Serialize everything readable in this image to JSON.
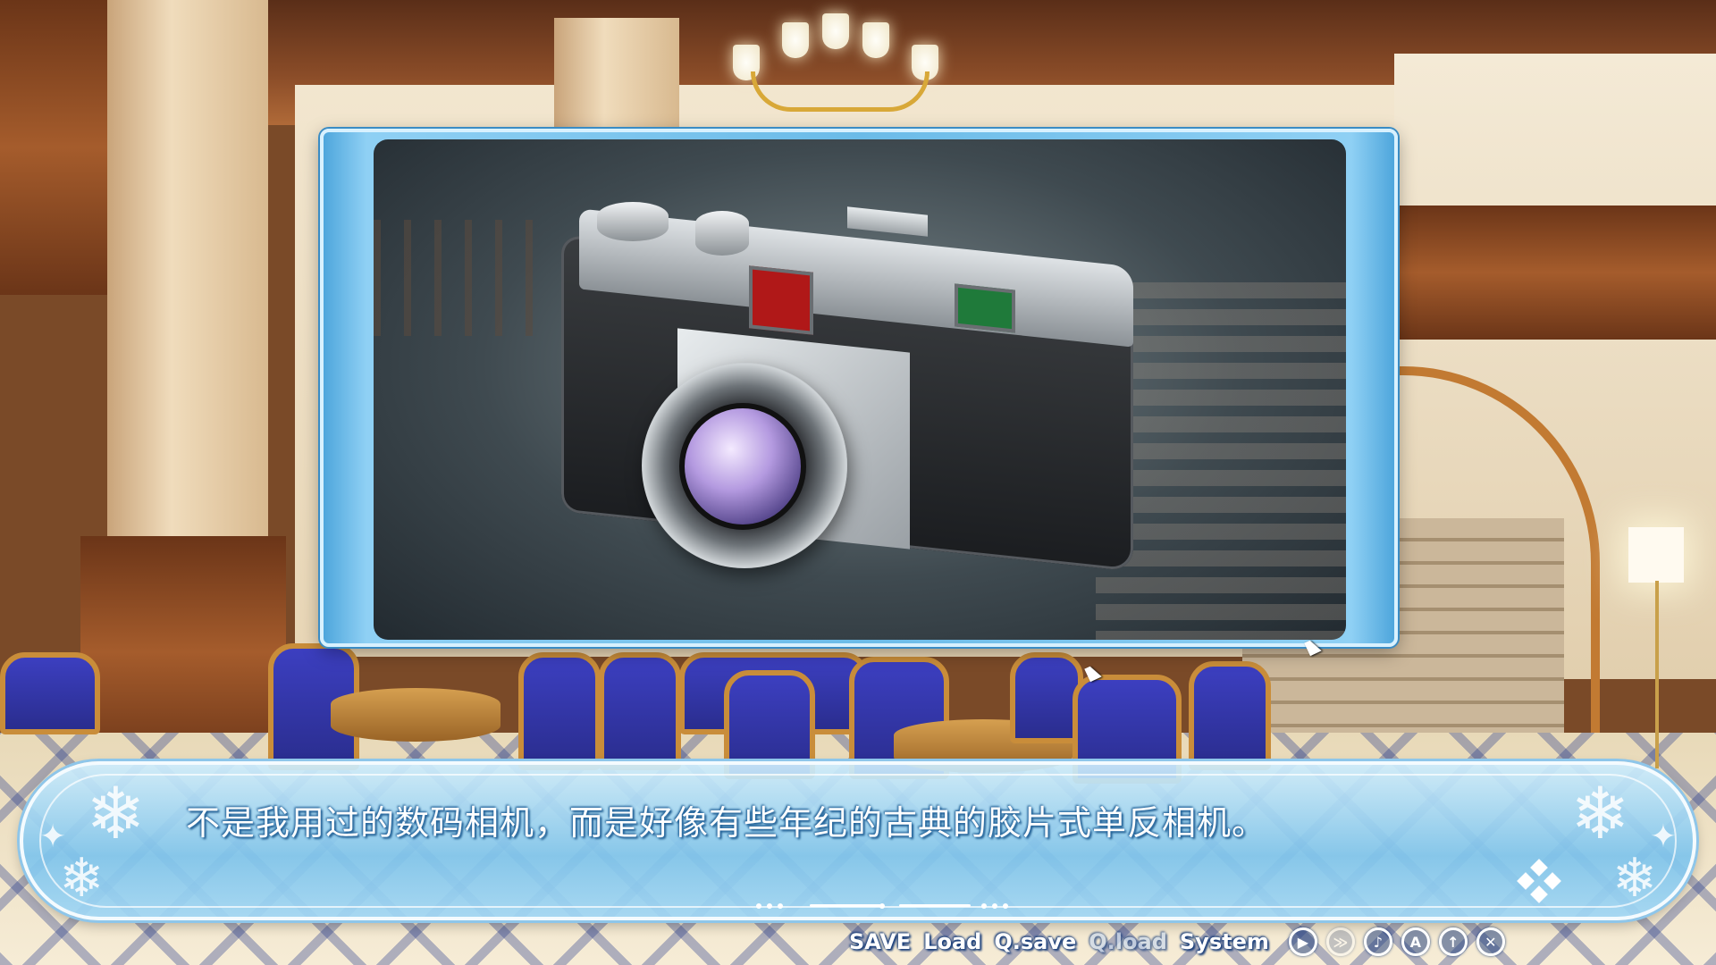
{
  "dialogue": {
    "text": "不是我用过的数码相机，而是好像有些年纪的古典的胶片式单反相机。"
  },
  "cg": {
    "subject": "camera"
  },
  "menu": {
    "items": [
      {
        "label": "SAVE",
        "enabled": true
      },
      {
        "label": "Load",
        "enabled": true
      },
      {
        "label": "Q.save",
        "enabled": true
      },
      {
        "label": "Q.load",
        "enabled": false
      },
      {
        "label": "System",
        "enabled": true
      }
    ],
    "icons": [
      {
        "name": "auto-play-icon",
        "glyph": "▶",
        "enabled": true
      },
      {
        "name": "skip-icon",
        "glyph": "≫",
        "enabled": false
      },
      {
        "name": "music-icon",
        "glyph": "♪",
        "enabled": true
      },
      {
        "name": "auto-mode-icon",
        "glyph": "A",
        "enabled": true
      },
      {
        "name": "hide-window-icon",
        "glyph": "↑",
        "enabled": true
      },
      {
        "name": "close-icon",
        "glyph": "✕",
        "enabled": true
      }
    ]
  },
  "colors": {
    "frame_blue": "#6bbbe8",
    "dialog_blue": "#7ec4ec",
    "text_outline": "#1e5a8e"
  }
}
